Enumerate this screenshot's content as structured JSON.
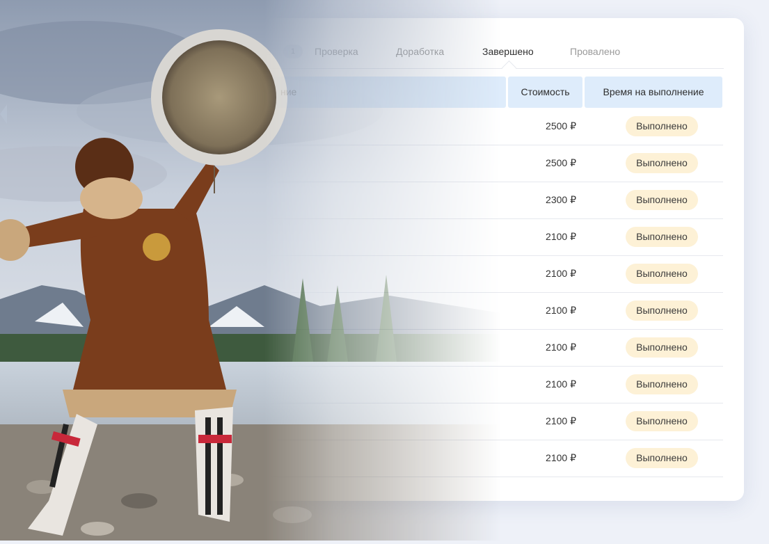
{
  "tabs": [
    {
      "label": "Проверка",
      "active": false
    },
    {
      "label": "Доработка",
      "active": false
    },
    {
      "label": "Завершено",
      "active": true
    },
    {
      "label": "Провалено",
      "active": false
    }
  ],
  "partial_tab": {
    "label_tail": "е",
    "count": "1"
  },
  "table": {
    "headers": {
      "name_tail": "ние",
      "cost": "Стоимость",
      "time": "Время на выполнение"
    },
    "rows": [
      {
        "price": "2500 ₽",
        "status": "Выполнено"
      },
      {
        "price": "2500 ₽",
        "status": "Выполнено"
      },
      {
        "price": "2300 ₽",
        "status": "Выполнено"
      },
      {
        "price": "2100 ₽",
        "status": "Выполнено"
      },
      {
        "price": "2100 ₽",
        "status": "Выполнено"
      },
      {
        "price": "2100 ₽",
        "status": "Выполнено"
      },
      {
        "price": "2100 ₽",
        "status": "Выполнено"
      },
      {
        "price": "2100 ₽",
        "status": "Выполнено"
      },
      {
        "price": "2100 ₽",
        "status": "Выполнено"
      },
      {
        "price": "2100 ₽",
        "status": "Выполнено"
      }
    ]
  },
  "colors": {
    "header_bg": "#deecfb",
    "badge_bg": "#fdf1d6",
    "active_tab": "#2e2e2e",
    "inactive_tab": "#9a9a9a"
  },
  "illustration": {
    "subject": "shaman-with-drum-photo"
  }
}
